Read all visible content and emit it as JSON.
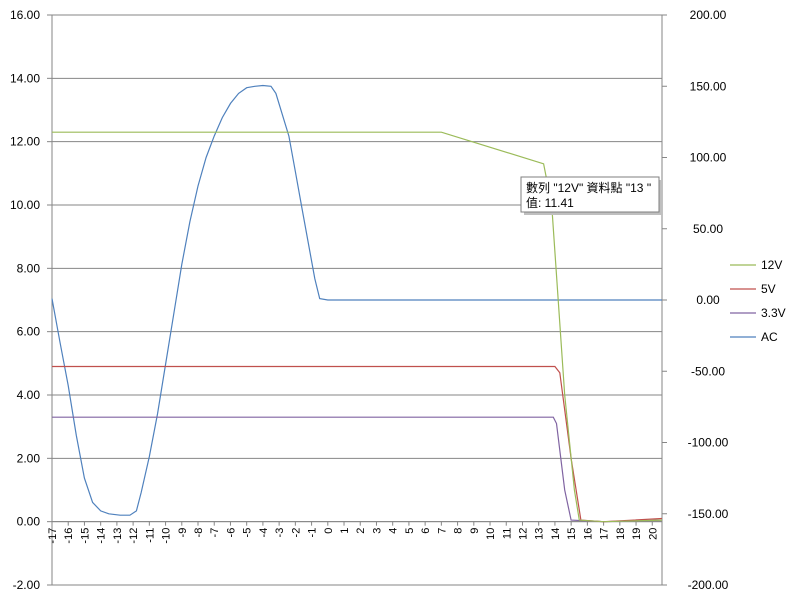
{
  "chart_data": {
    "type": "line",
    "title": "",
    "xlabel": "",
    "ylabel": "",
    "y2label": "",
    "x_ticks": [
      "-17",
      "-16",
      "-15",
      "-14",
      "-13",
      "-12",
      "-11",
      "-10",
      "-9",
      "-8",
      "-7",
      "-6",
      "-5",
      "-4",
      "-3",
      "-2",
      "-1",
      "0",
      "1",
      "2",
      "3",
      "4",
      "5",
      "6",
      "7",
      "8",
      "9",
      "10",
      "11",
      "12",
      "13",
      "14",
      "15",
      "16",
      "17",
      "18",
      "19",
      "20"
    ],
    "x_range": [
      -17,
      20.6
    ],
    "y_left": {
      "range": [
        -2,
        16
      ],
      "ticks": [
        -2,
        0,
        2,
        4,
        6,
        8,
        10,
        12,
        14,
        16
      ],
      "tick_labels": [
        "-2.00",
        "0.00",
        "2.00",
        "4.00",
        "6.00",
        "8.00",
        "10.00",
        "12.00",
        "14.00",
        "16.00"
      ]
    },
    "y_right": {
      "range": [
        -200,
        200
      ],
      "ticks": [
        -200,
        -150,
        -100,
        -50,
        0,
        50,
        100,
        150,
        200
      ],
      "tick_labels": [
        "-200.00",
        "-150.00",
        "-100.00",
        "-50.00",
        "0.00",
        "50.00",
        "100.00",
        "150.00",
        "200.00"
      ]
    },
    "grid": true,
    "legend_position": "right",
    "series": [
      {
        "name": "12V",
        "axis": "left",
        "color": "#9bbb59",
        "points": [
          [
            -17,
            12.3
          ],
          [
            7,
            12.3
          ],
          [
            13.3,
            11.3
          ],
          [
            13.8,
            10.0
          ],
          [
            14.2,
            7.0
          ],
          [
            14.6,
            4.0
          ],
          [
            15.2,
            1.0
          ],
          [
            15.5,
            0.05
          ],
          [
            17,
            0
          ],
          [
            20.6,
            0.05
          ]
        ]
      },
      {
        "name": "5V",
        "axis": "left",
        "color": "#c0504d",
        "points": [
          [
            -17,
            4.9
          ],
          [
            14,
            4.9
          ],
          [
            14.3,
            4.7
          ],
          [
            15.0,
            2.0
          ],
          [
            15.6,
            0.05
          ],
          [
            17,
            0
          ],
          [
            20.6,
            0.1
          ]
        ]
      },
      {
        "name": "3.3V",
        "axis": "left",
        "color": "#8064a2",
        "points": [
          [
            -17,
            3.3
          ],
          [
            13.9,
            3.3
          ],
          [
            14.1,
            3.1
          ],
          [
            14.6,
            1.0
          ],
          [
            15.0,
            0.05
          ],
          [
            17,
            0
          ],
          [
            20.6,
            0.05
          ]
        ]
      },
      {
        "name": "AC",
        "axis": "right",
        "color": "#4f81bd",
        "points": [
          [
            -17,
            1
          ],
          [
            -16.5,
            -30
          ],
          [
            -16,
            -60
          ],
          [
            -15.5,
            -95
          ],
          [
            -15,
            -125
          ],
          [
            -14.5,
            -142
          ],
          [
            -14,
            -148
          ],
          [
            -13.5,
            -150
          ],
          [
            -12.8,
            -151
          ],
          [
            -12.2,
            -151
          ],
          [
            -11.8,
            -148
          ],
          [
            -11.5,
            -135
          ],
          [
            -11,
            -110
          ],
          [
            -10.5,
            -80
          ],
          [
            -10,
            -45
          ],
          [
            -9.5,
            -10
          ],
          [
            -9,
            25
          ],
          [
            -8.5,
            55
          ],
          [
            -8,
            80
          ],
          [
            -7.5,
            100
          ],
          [
            -7,
            115
          ],
          [
            -6.5,
            128
          ],
          [
            -6,
            138
          ],
          [
            -5.5,
            145
          ],
          [
            -5,
            149
          ],
          [
            -4.5,
            150
          ],
          [
            -4,
            150.5
          ],
          [
            -3.5,
            150
          ],
          [
            -3.2,
            145
          ],
          [
            -2.8,
            130
          ],
          [
            -2.4,
            115
          ],
          [
            -2,
            90
          ],
          [
            -1.6,
            65
          ],
          [
            -1.2,
            40
          ],
          [
            -0.8,
            15
          ],
          [
            -0.5,
            1
          ],
          [
            0,
            0
          ],
          [
            20.6,
            0
          ]
        ]
      }
    ],
    "tooltip": {
      "line1": "數列 \"12V\" 資料點 \"13 \"",
      "line2": "值: 11.41"
    }
  }
}
